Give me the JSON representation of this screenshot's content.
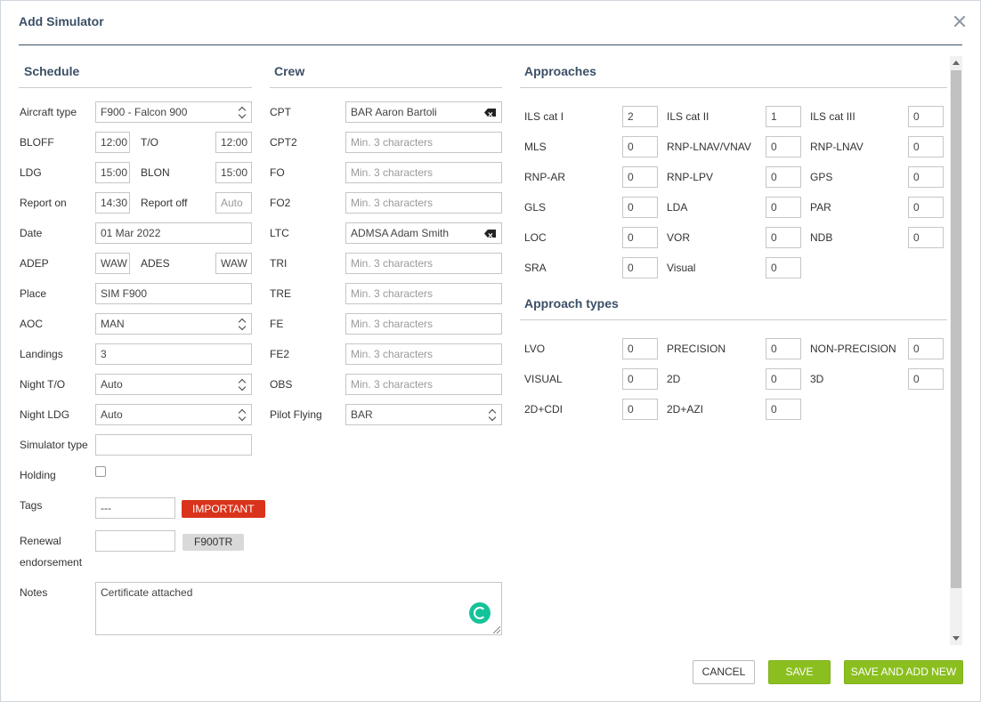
{
  "dialog": {
    "title": "Add Simulator"
  },
  "schedule": {
    "title": "Schedule",
    "aircraft_type_label": "Aircraft type",
    "aircraft_type_value": "F900 - Falcon 900",
    "bloff_label": "BLOFF",
    "bloff_value": "12:00",
    "to_label": "T/O",
    "to_value": "12:00",
    "ldg_label": "LDG",
    "ldg_value": "15:00",
    "blon_label": "BLON",
    "blon_value": "15:00",
    "report_on_label": "Report on",
    "report_on_value": "14:30",
    "report_off_label": "Report off",
    "report_off_placeholder": "Auto",
    "date_label": "Date",
    "date_value": "01 Mar 2022",
    "adep_label": "ADEP",
    "adep_value": "WAW",
    "ades_label": "ADES",
    "ades_value": "WAW",
    "place_label": "Place",
    "place_value": "SIM F900",
    "aoc_label": "AOC",
    "aoc_value": "MAN",
    "landings_label": "Landings",
    "landings_value": "3",
    "night_to_label": "Night T/O",
    "night_to_value": "Auto",
    "night_ldg_label": "Night LDG",
    "night_ldg_value": "Auto",
    "sim_type_label": "Simulator type",
    "sim_type_value": "",
    "holding_label": "Holding",
    "tags_label": "Tags",
    "tags_value": "---",
    "tag_important": "IMPORTANT",
    "renewal_label_1": "Renewal",
    "renewal_label_2": "endorsement",
    "renewal_value": "",
    "renewal_chip": "F900TR",
    "notes_label": "Notes",
    "notes_value": "Certificate attached"
  },
  "crew": {
    "title": "Crew",
    "placeholder": "Min. 3 characters",
    "rows": [
      {
        "label": "CPT",
        "value": "BAR Aaron  Bartoli"
      },
      {
        "label": "CPT2",
        "value": ""
      },
      {
        "label": "FO",
        "value": ""
      },
      {
        "label": "FO2",
        "value": ""
      },
      {
        "label": "LTC",
        "value": "ADMSA Adam Smith"
      },
      {
        "label": "TRI",
        "value": ""
      },
      {
        "label": "TRE",
        "value": ""
      },
      {
        "label": "FE",
        "value": ""
      },
      {
        "label": "FE2",
        "value": ""
      },
      {
        "label": "OBS",
        "value": ""
      }
    ],
    "pilot_flying_label": "Pilot Flying",
    "pilot_flying_value": "BAR"
  },
  "approaches": {
    "title": "Approaches",
    "items": [
      {
        "label": "ILS cat I",
        "value": "2"
      },
      {
        "label": "ILS cat II",
        "value": "1"
      },
      {
        "label": "ILS cat III",
        "value": "0"
      },
      {
        "label": "MLS",
        "value": "0"
      },
      {
        "label": "RNP-LNAV/VNAV",
        "value": "0"
      },
      {
        "label": "RNP-LNAV",
        "value": "0"
      },
      {
        "label": "RNP-AR",
        "value": "0"
      },
      {
        "label": "RNP-LPV",
        "value": "0"
      },
      {
        "label": "GPS",
        "value": "0"
      },
      {
        "label": "GLS",
        "value": "0"
      },
      {
        "label": "LDA",
        "value": "0"
      },
      {
        "label": "PAR",
        "value": "0"
      },
      {
        "label": "LOC",
        "value": "0"
      },
      {
        "label": "VOR",
        "value": "0"
      },
      {
        "label": "NDB",
        "value": "0"
      },
      {
        "label": "SRA",
        "value": "0"
      },
      {
        "label": "Visual",
        "value": "0"
      }
    ]
  },
  "approach_types": {
    "title": "Approach types",
    "items": [
      {
        "label": "LVO",
        "value": "0"
      },
      {
        "label": "PRECISION",
        "value": "0"
      },
      {
        "label": "NON-PRECISION",
        "value": "0"
      },
      {
        "label": "VISUAL",
        "value": "0"
      },
      {
        "label": "2D",
        "value": "0"
      },
      {
        "label": "3D",
        "value": "0"
      },
      {
        "label": "2D+CDI",
        "value": "0"
      },
      {
        "label": "2D+AZI",
        "value": "0"
      }
    ]
  },
  "footer": {
    "cancel": "CANCEL",
    "save": "SAVE",
    "save_add_new": "SAVE AND ADD NEW"
  },
  "colors": {
    "heading": "#3b4f66",
    "important_tag": "#d9331c",
    "save_green": "#8bbf1f"
  },
  "icons": [
    "close-icon",
    "select-arrows-icon",
    "clear-input-icon",
    "grammarly-icon",
    "resize-handle-icon"
  ]
}
